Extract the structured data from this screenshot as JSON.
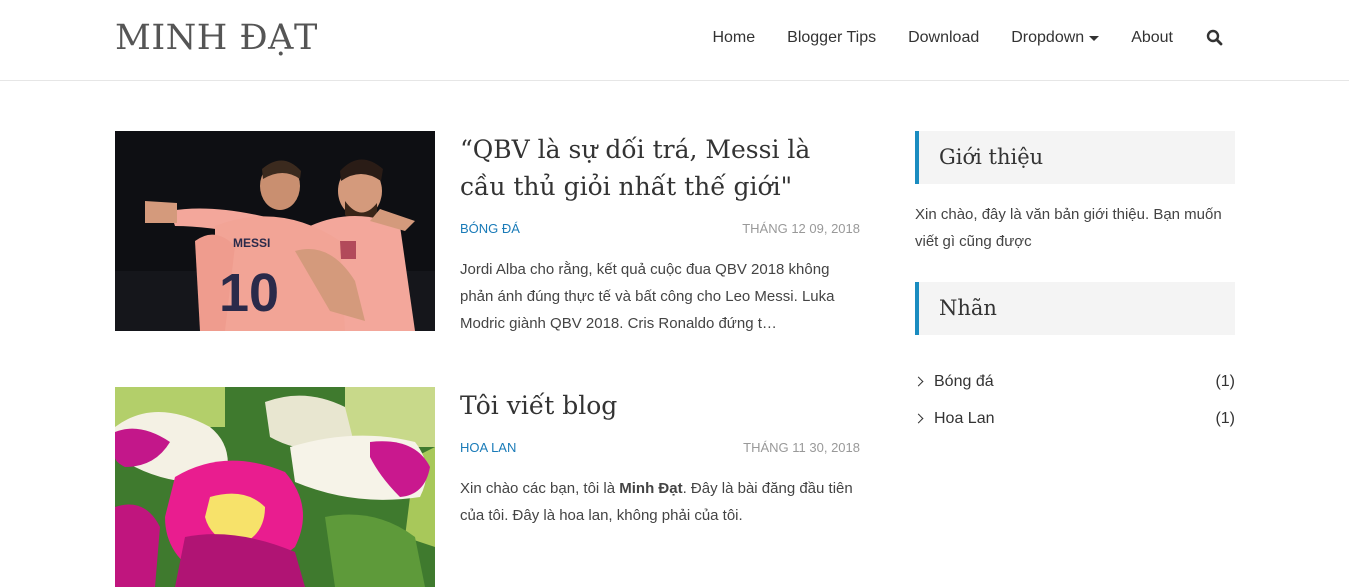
{
  "site": {
    "title": "MINH ĐẠT"
  },
  "nav": {
    "items": [
      {
        "label": "Home"
      },
      {
        "label": "Blogger Tips"
      },
      {
        "label": "Download"
      },
      {
        "label": "Dropdown"
      },
      {
        "label": "About"
      }
    ],
    "search_icon": "search-icon"
  },
  "posts": [
    {
      "title": "“QBV là sự dối trá, Messi là cầu thủ giỏi nhất thế giới\"",
      "label": "BÓNG ĐÁ",
      "date": "THÁNG 12 09, 2018",
      "excerpt": "Jordi Alba cho rằng, kết quả cuộc đua QBV 2018 không phản ánh đúng thực tế và bất công cho Leo Messi. Luka Modric giành QBV 2018. Cris Ronaldo đứng t…",
      "thumb_jersey_name": "MESSI",
      "thumb_jersey_number": "10"
    },
    {
      "title": "Tôi viết blog",
      "label": "HOA LAN",
      "date": "THÁNG 11 30, 2018",
      "excerpt_before": "Xin chào các bạn, tôi là ",
      "excerpt_bold": "Minh Đạt",
      "excerpt_after": ". Đây là bài đăng đầu tiên của tôi. Đây là hoa lan, không phải của tôi."
    }
  ],
  "sidebar": {
    "intro": {
      "title": "Giới thiệu",
      "text": "Xin chào, đây là văn bản giới thiệu. Bạn muốn viết gì cũng được"
    },
    "labels": {
      "title": "Nhãn",
      "items": [
        {
          "name": "Bóng đá",
          "count": "(1)"
        },
        {
          "name": "Hoa Lan",
          "count": "(1)"
        }
      ]
    }
  },
  "colors": {
    "accent": "#1a8cc0",
    "label": "#1a7bb8",
    "muted": "#999999"
  }
}
